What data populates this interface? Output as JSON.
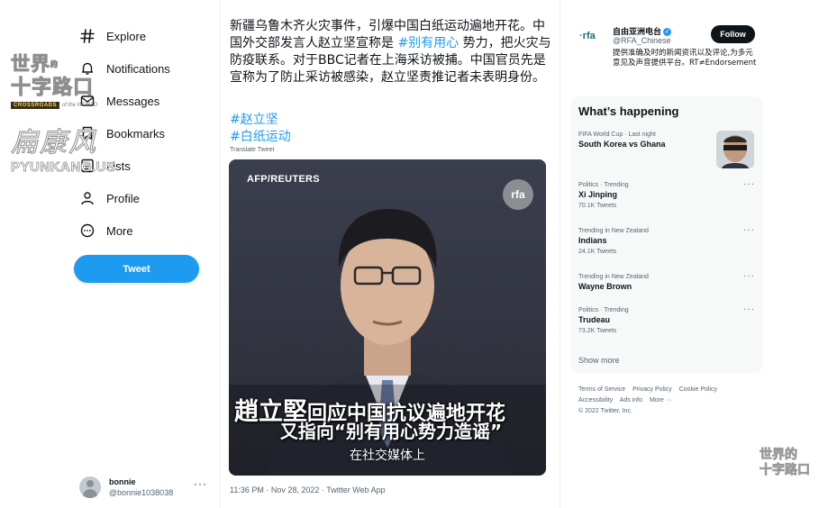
{
  "nav": {
    "items": [
      {
        "label": "Explore",
        "icon": "hashtag-icon"
      },
      {
        "label": "Notifications",
        "icon": "bell-icon"
      },
      {
        "label": "Messages",
        "icon": "envelope-icon"
      },
      {
        "label": "Bookmarks",
        "icon": "bookmark-icon"
      },
      {
        "label": "Lists",
        "icon": "list-icon"
      },
      {
        "label": "Profile",
        "icon": "person-icon"
      },
      {
        "label": "More",
        "icon": "more-circle-icon"
      }
    ],
    "tweet_button": "Tweet"
  },
  "account": {
    "name": "bonnie",
    "handle": "@bonnie1038038",
    "more": "···"
  },
  "watermark": {
    "line1": "世界",
    "line1_small": "的",
    "line2": "十字路口",
    "tag": "CROSSROADS",
    "tag_rest": "of the WORLD",
    "script": "扁康风",
    "url": "PYUNKANG.US",
    "corner_line1": "世界的",
    "corner_line2": "十字路口"
  },
  "tweet": {
    "text_part1": "新疆乌鲁木齐火灾事件，引爆中国白纸运动遍地开花。中国外交部发言人赵立坚宣称是 ",
    "text_highlight": "#别有用心",
    "text_part2": " 势力，把火灾与防疫联系。对于BBC记者在上海采访被捕。中国官员先是宣称为了防止采访被感染，赵立坚责推记者未表明身份。",
    "hashtags": [
      "#赵立坚",
      "#白纸运动"
    ],
    "translate": "Translate Tweet",
    "media": {
      "source": "AFP/REUTERS",
      "logo": "rfa",
      "subtitle_name": "趙立堅",
      "subtitle_line1": "回应中国抗议遍地开花",
      "subtitle_line2": "又指向“别有用心势力造谣”",
      "subtitle_line3": "在社交媒体上"
    },
    "meta": "11:36 PM · Nov 28, 2022 · Twitter Web App"
  },
  "rfa": {
    "logo": "rfa",
    "name": "自由亚洲电台",
    "handle": "@RFA_Chinese",
    "follow": "Follow",
    "bio": "提供准确及时的新闻资讯以及评论,为多元意见及声音提供平台。RT≠Endorsement"
  },
  "trends": {
    "title": "What’s happening",
    "items": [
      {
        "context": "FIFA World Cup · Last night",
        "name": "South Korea vs Ghana",
        "count": ""
      },
      {
        "context": "Politics · Trending",
        "name": "Xi Jinping",
        "count": "70.1K Tweets"
      },
      {
        "context": "Trending in New Zealand",
        "name": "Indians",
        "count": "24.1K Tweets"
      },
      {
        "context": "Trending in New Zealand",
        "name": "Wayne Brown",
        "count": ""
      },
      {
        "context": "Politics · Trending",
        "name": "Trudeau",
        "count": "73.2K Tweets"
      }
    ],
    "show_more": "Show more",
    "more": "···"
  },
  "footer": {
    "links": [
      "Terms of Service",
      "Privacy Policy",
      "Cookie Policy",
      "Accessibility",
      "Ads info",
      "More ···"
    ],
    "copyright": "© 2022 Twitter, Inc."
  },
  "colors": {
    "accent": "#1d9bf0",
    "text": "#0f1419",
    "muted": "#536471",
    "panel": "#f7f9f9"
  }
}
